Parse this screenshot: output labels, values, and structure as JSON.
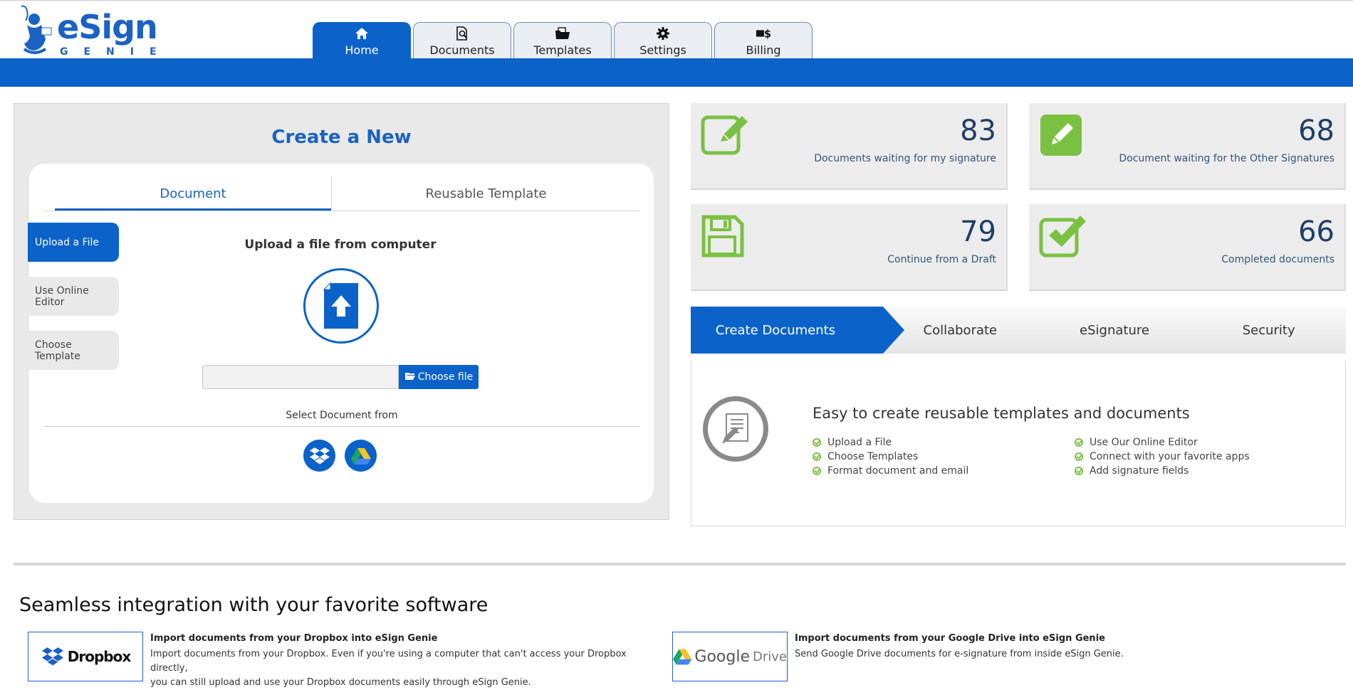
{
  "brand": {
    "name": "eSign",
    "sub": "GENIE"
  },
  "nav": {
    "tabs": [
      {
        "label": "Home",
        "icon": "home-icon"
      },
      {
        "label": "Documents",
        "icon": "document-search-icon"
      },
      {
        "label": "Templates",
        "icon": "folder-icon"
      },
      {
        "label": "Settings",
        "icon": "gear-icon"
      },
      {
        "label": "Billing",
        "icon": "billing-icon"
      }
    ],
    "active": "Home"
  },
  "create": {
    "title": "Create a New",
    "tabs": [
      "Document",
      "Reusable Template"
    ],
    "side_buttons": [
      "Upload a File",
      "Use Online Editor",
      "Choose Template"
    ],
    "upload_title": "Upload a file from computer",
    "choose_file_label": "Choose file",
    "file_value": "",
    "select_from": "Select Document from",
    "sources": [
      "dropbox-icon",
      "google-drive-icon"
    ]
  },
  "stats": [
    {
      "value": "83",
      "label": "Documents waiting for my signature",
      "icon": "edit-icon"
    },
    {
      "value": "68",
      "label": "Document waiting for the Other Signatures",
      "icon": "pencil-icon"
    },
    {
      "value": "79",
      "label": "Continue from a Draft",
      "icon": "save-icon"
    },
    {
      "value": "66",
      "label": "Completed documents",
      "icon": "checkbox-icon"
    }
  ],
  "features": {
    "tabs": [
      "Create Documents",
      "Collaborate",
      "eSignature",
      "Security"
    ],
    "title": "Easy to create reusable templates and documents",
    "left_items": [
      "Upload a File",
      "Choose Templates",
      "Format document and email"
    ],
    "right_items": [
      "Use Our Online Editor",
      "Connect with your favorite apps",
      "Add signature fields"
    ]
  },
  "integrations": {
    "title": "Seamless integration with your favorite software",
    "items": [
      {
        "logo": "Dropbox",
        "heading": "Import documents from your Dropbox into eSign Genie",
        "desc_1": "Import documents from your Dropbox. Even if you're using a computer that can't access your Dropbox directly,",
        "desc_2": "you can still upload and use your Dropbox documents easily through eSign Genie."
      },
      {
        "logo_a": "Google",
        "logo_b": "Drive",
        "heading": "Import documents from your Google Drive into eSign Genie",
        "desc_1": "Send Google Drive documents for e-signature from inside eSign Genie."
      }
    ]
  },
  "colors": {
    "primary": "#0b62c9",
    "green": "#7ac142",
    "stat_number": "#1e3f66"
  }
}
